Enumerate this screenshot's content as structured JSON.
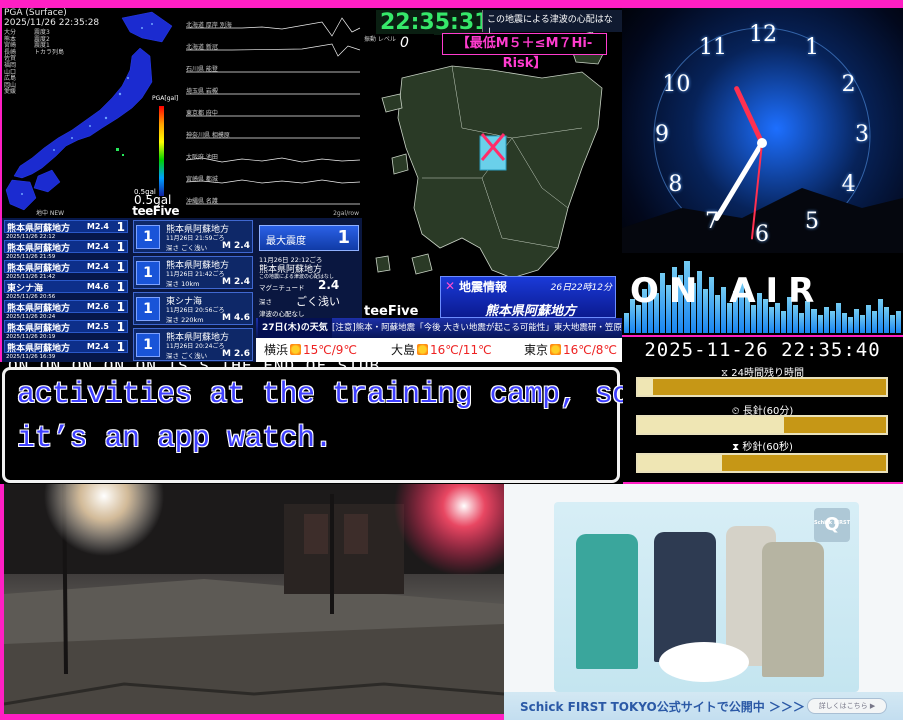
{
  "colors": {
    "frame": "#ff1fc4",
    "subtitle_text": "#3e3fff",
    "risk": "#ff3ccf",
    "clock_green": "#36e86a",
    "progress_gold": "#c69716",
    "progress_cream": "#efe6b4"
  },
  "map_panel": {
    "header_line1": "PGA (Surface)",
    "header_line2": "2025/11/26 22:35:28",
    "station_list": [
      "大分",
      "熊本",
      "宮崎",
      "長崎",
      "佐賀",
      "福岡",
      "山口",
      "広島",
      "岡山",
      "愛媛"
    ],
    "station_list2": [
      "震度3",
      "震度2",
      "震度1",
      "トカラ列島"
    ],
    "pga_unit": "PGA[gal]",
    "pga_small": "0.5gal",
    "pga_value": "0.5gal",
    "new_label": "地中 NEW",
    "brand": "teeFive"
  },
  "wave_panel": {
    "stations": [
      "北海道 厚岸 別海",
      "北海道 新冠",
      "石川県 能登",
      "埼玉県 岩槻",
      "東京都 府中",
      "神奈川県 相模原",
      "大阪府 池田",
      "宮崎県 都城",
      "沖縄県 名護"
    ],
    "scale": "2gal/row"
  },
  "kyushu_panel": {
    "clock": "22:35:31",
    "tsunami_note": "この地震による津波の心配はなし",
    "level_label": "振動\nレベル",
    "level_value": "0",
    "risk_label": "【最低M５＋≤M７Hi-Risk】",
    "brand": "teeFive",
    "info_title": "地震情報",
    "info_time": "26日22時12分",
    "info_region": "熊本県阿蘇地方",
    "x_mark": "✕"
  },
  "clock_panel": {
    "numerals": [
      "12",
      "1",
      "2",
      "3",
      "4",
      "5",
      "6",
      "7",
      "8",
      "9",
      "10",
      "11"
    ],
    "hour_hand_deg": 335,
    "minute_hand_deg": 211,
    "second_hand_deg": 186
  },
  "onair_panel": {
    "title": "ON AIR"
  },
  "countdown_panel": {
    "datetime": "2025-11-26 22:35:40",
    "bars": [
      {
        "label": "24時間残り時間",
        "icon": "hourglass-icon",
        "glyph": "⧖",
        "fill": 0.06
      },
      {
        "label": "長針(60分)",
        "icon": "clock-icon",
        "glyph": "⏲",
        "fill": 0.59
      },
      {
        "label": "秒針(60秒)",
        "icon": "hourglass-icon",
        "glyph": "⧗",
        "fill": 0.34
      }
    ]
  },
  "quake_list": [
    {
      "region": "熊本県阿蘇地方",
      "date": "2025/11/26 22:12",
      "mag": "M2.4",
      "intensity": "1"
    },
    {
      "region": "熊本県阿蘇地方",
      "date": "2025/11/26 21:59",
      "mag": "M2.4",
      "intensity": "1"
    },
    {
      "region": "熊本県阿蘇地方",
      "date": "2025/11/26 21:42",
      "mag": "M2.4",
      "intensity": "1"
    },
    {
      "region": "東シナ海",
      "date": "2025/11/26 20:56",
      "mag": "M4.6",
      "intensity": "1"
    },
    {
      "region": "熊本県阿蘇地方",
      "date": "2025/11/26 20:24",
      "mag": "M2.6",
      "intensity": "1"
    },
    {
      "region": "熊本県阿蘇地方",
      "date": "2025/11/26 20:19",
      "mag": "M2.5",
      "intensity": "1"
    },
    {
      "region": "熊本県阿蘇地方",
      "date": "2025/11/26 16:39",
      "mag": "M2.4",
      "intensity": "1"
    }
  ],
  "quake_list_tag": "最大震度",
  "quake_detail": [
    {
      "region": "熊本県阿蘇地方",
      "time": "11月26日 21:59ごろ",
      "depth": "深さ ごく浅い",
      "mag": "M 2.4",
      "intensity": "1"
    },
    {
      "region": "熊本県阿蘇地方",
      "time": "11月26日 21:42ごろ",
      "depth": "深さ 10km",
      "mag": "M 2.4",
      "intensity": "1"
    },
    {
      "region": "東シナ海",
      "time": "11月26日 20:56ごろ",
      "depth": "深さ 220km",
      "mag": "M 4.6",
      "intensity": "1"
    },
    {
      "region": "熊本県阿蘇地方",
      "time": "11月26日 20:24ごろ",
      "depth": "深さ ごく浅い",
      "mag": "M 2.6",
      "intensity": "1"
    }
  ],
  "latest_detail": {
    "max_label": "最大震度",
    "max_value": "1",
    "time": "11月26日 22:12ごろ",
    "region": "熊本県阿蘇地方",
    "tsunami": "この地震による津波の心配はなし",
    "mag_label": "マグニチュード",
    "mag_value": "2.4",
    "depth_label": "深さ",
    "depth_value": "ごく浅い",
    "note": "津波の心配なし"
  },
  "ticker": {
    "day": "27日(木)の天気",
    "warning": "[注意]熊本・阿蘇地震「今後 大きい地震が起こる可能性」東大地震研・笠原教授",
    "weather": [
      {
        "city": "横浜",
        "temps": "15℃/9℃"
      },
      {
        "city": "大島",
        "temps": "16℃/11℃"
      },
      {
        "city": "東京",
        "temps": "16℃/8℃"
      }
    ]
  },
  "subtitle": {
    "cut_line": "ON ON ON ON ON IS S THE END OF STUB",
    "line1": "activities at the training camp, so",
    "line2": "it’s an app watch."
  },
  "ad": {
    "footer": "Schick FIRST TOKYO公式サイトで公開中 ＞＞＞",
    "button": "詳しくはこちら ▶",
    "logo_top": "Schick FIRST",
    "logo": "Q"
  }
}
